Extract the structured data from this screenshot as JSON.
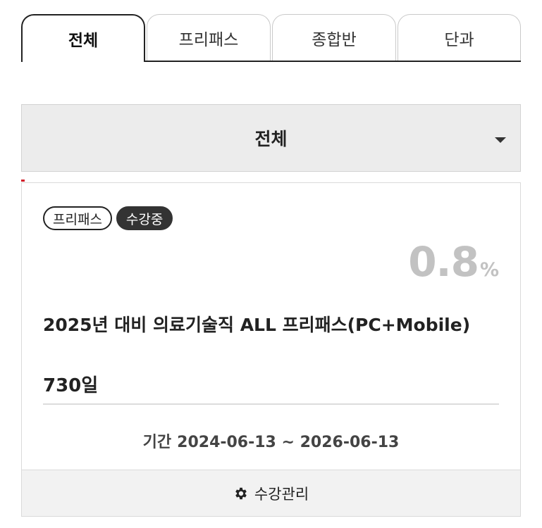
{
  "tabs": [
    {
      "label": "전체",
      "active": true
    },
    {
      "label": "프리패스",
      "active": false
    },
    {
      "label": "종합반",
      "active": false
    },
    {
      "label": "단과",
      "active": false
    }
  ],
  "filter": {
    "selected": "전체"
  },
  "course": {
    "badges": [
      "프리패스",
      "수강중"
    ],
    "progress_value": "0.8",
    "progress_unit": "%",
    "title": "2025년 대비 의료기술직 ALL 프리패스(PC+Mobile)",
    "duration": "730일",
    "period_label": "기간",
    "period_value": "2024-06-13 ~ 2026-06-13",
    "manage_label": "수강관리"
  },
  "icons": {
    "dropdown": "caret-down-icon",
    "manage": "gear-icon"
  },
  "colors": {
    "accent": "#d21f2a",
    "badge_dark": "#333333",
    "progress": "#c2c2c2"
  }
}
